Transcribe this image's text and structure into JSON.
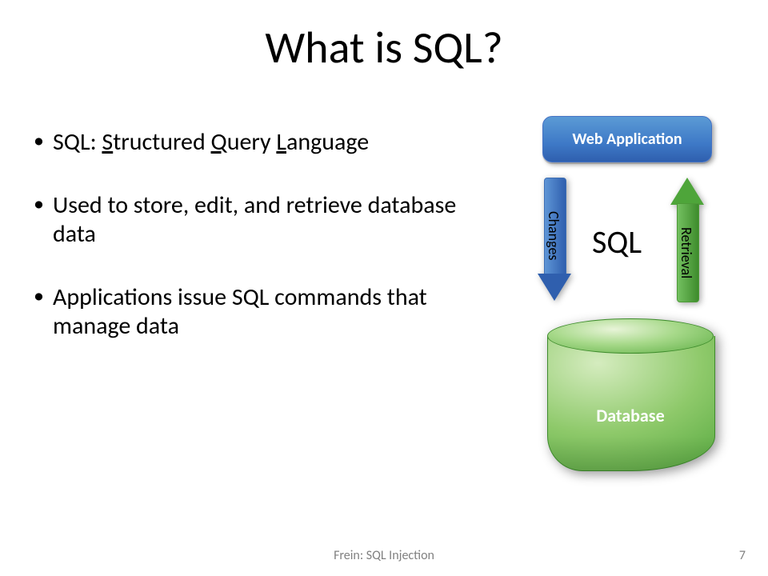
{
  "title": "What is SQL?",
  "bullets": [
    {
      "prefix": "SQL: ",
      "s": "S",
      "s_rest": "tructured ",
      "q": "Q",
      "q_rest": "uery ",
      "l": "L",
      "l_rest": "anguage"
    },
    {
      "text": "Used to store, edit, and retrieve database data"
    },
    {
      "text": "Applications issue SQL commands that manage data"
    }
  ],
  "diagram": {
    "webapp_label": "Web Application",
    "sql_label": "SQL",
    "changes_label": "Changes",
    "retrieval_label": "Retrieval",
    "database_label": "Database"
  },
  "footer": {
    "text": "Frein: SQL Injection",
    "page": "7"
  }
}
